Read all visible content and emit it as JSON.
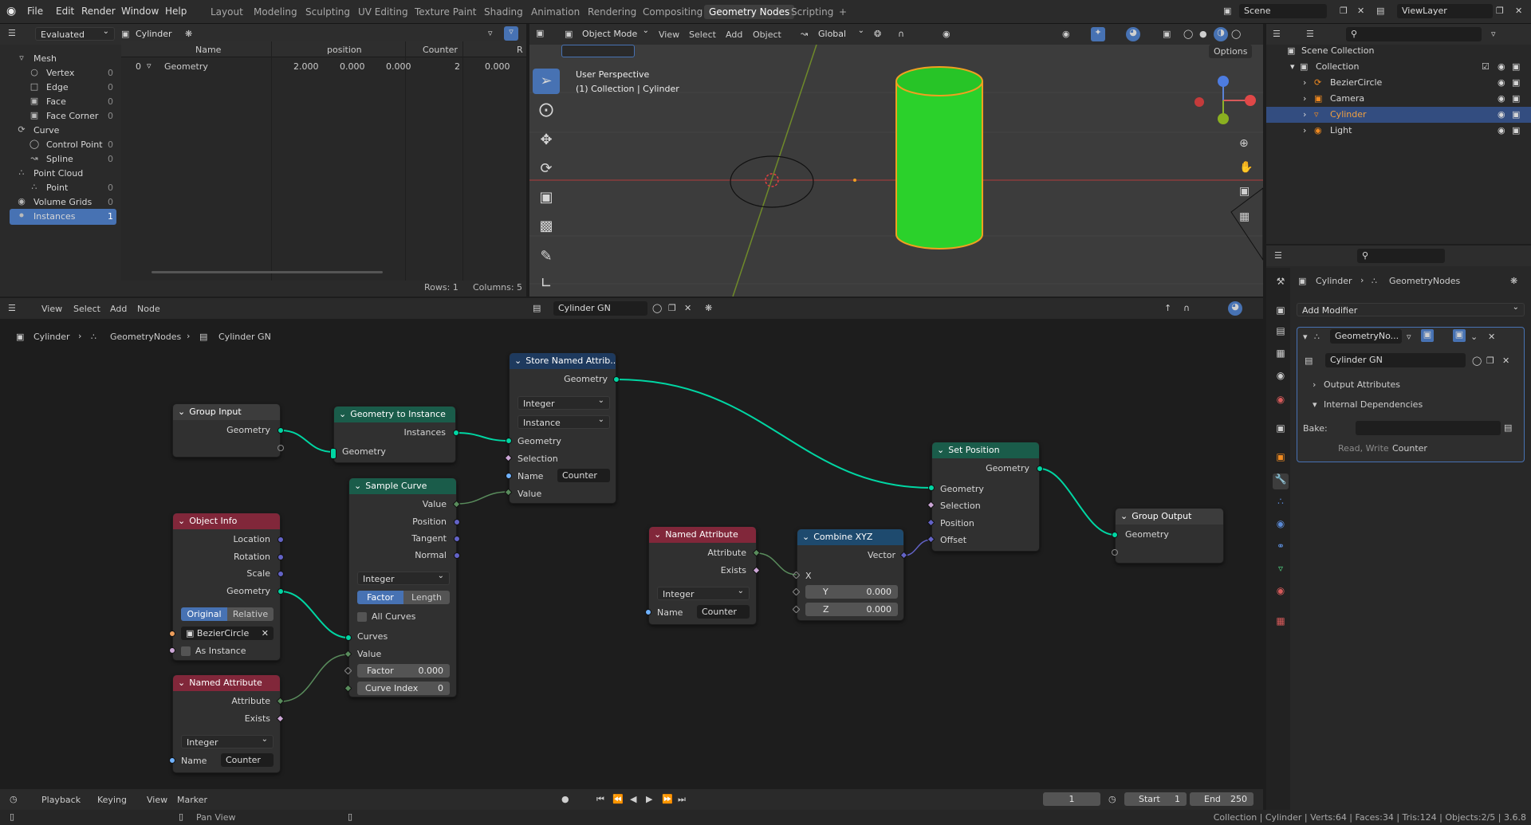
{
  "topbar": {
    "menus": [
      "File",
      "Edit",
      "Render",
      "Window",
      "Help"
    ],
    "workspaces": [
      "Layout",
      "Modeling",
      "Sculpting",
      "UV Editing",
      "Texture Paint",
      "Shading",
      "Animation",
      "Rendering",
      "Compositing",
      "Geometry Nodes",
      "Scripting"
    ],
    "active_workspace": "Geometry Nodes",
    "plus": "+",
    "scene": "Scene",
    "view_layer": "ViewLayer"
  },
  "spreadsheet": {
    "mode": "Evaluated",
    "object": "Cylinder",
    "tree": [
      {
        "label": "Mesh",
        "count": "",
        "sub": false,
        "icon": "mesh-icon"
      },
      {
        "label": "Vertex",
        "count": "0",
        "sub": true
      },
      {
        "label": "Edge",
        "count": "0",
        "sub": true
      },
      {
        "label": "Face",
        "count": "0",
        "sub": true
      },
      {
        "label": "Face Corner",
        "count": "0",
        "sub": true
      },
      {
        "label": "Curve",
        "count": "",
        "sub": false
      },
      {
        "label": "Control Point",
        "count": "0",
        "sub": true
      },
      {
        "label": "Spline",
        "count": "0",
        "sub": true
      },
      {
        "label": "Point Cloud",
        "count": "",
        "sub": false
      },
      {
        "label": "Point",
        "count": "0",
        "sub": true
      },
      {
        "label": "Volume Grids",
        "count": "0",
        "sub": false
      },
      {
        "label": "Instances",
        "count": "1",
        "sub": false,
        "active": true
      }
    ],
    "columns": [
      "Name",
      "position",
      "Counter",
      "R"
    ],
    "row": {
      "index": "0",
      "name": "Geometry",
      "px": "2.000",
      "py": "0.000",
      "pz": "0.000",
      "counter": "2",
      "r": "0.000"
    },
    "footer": {
      "rows": "Rows: 1",
      "cols": "Columns: 5"
    }
  },
  "viewport": {
    "mode": "Object Mode",
    "menus": [
      "View",
      "Select",
      "Add",
      "Object"
    ],
    "orientation": "Global",
    "options": "Options",
    "persp": "User Perspective",
    "collection": "(1) Collection | Cylinder",
    "colors": {
      "cylinder": "#2bd12b",
      "outline": "#f0a020"
    }
  },
  "outliner": {
    "root": "Scene Collection",
    "collection": "Collection",
    "items": [
      "BezierCircle",
      "Camera",
      "Cylinder",
      "Light"
    ],
    "active": "Cylinder"
  },
  "properties": {
    "breadcrumb": [
      "Cylinder",
      "GeometryNodes"
    ],
    "add_modifier": "Add Modifier",
    "modifier": "GeometryNo...",
    "tree": "Cylinder GN",
    "output_attrs": "Output Attributes",
    "internal_deps": "Internal Dependencies",
    "bake": "Bake:",
    "read_write": "Read, Write",
    "counter": "Counter"
  },
  "node_editor": {
    "menus": [
      "View",
      "Select",
      "Add",
      "Node"
    ],
    "tree_name": "Cylinder GN",
    "breadcrumb": [
      "Cylinder",
      "GeometryNodes",
      "Cylinder GN"
    ]
  },
  "nodes": {
    "group_input": {
      "title": "Group Input",
      "geometry": "Geometry"
    },
    "geo_to_inst": {
      "title": "Geometry to Instance",
      "instances": "Instances",
      "geometry": "Geometry"
    },
    "store": {
      "title": "Store Named Attrib...",
      "geometry_out": "Geometry",
      "type": "Integer",
      "domain": "Instance",
      "geometry": "Geometry",
      "selection": "Selection",
      "name": "Name",
      "name_val": "Counter",
      "value": "Value"
    },
    "sample": {
      "title": "Sample Curve",
      "value": "Value",
      "position": "Position",
      "tangent": "Tangent",
      "normal": "Normal",
      "type": "Integer",
      "factor": "Factor",
      "length": "Length",
      "all_curves": "All Curves",
      "curves": "Curves",
      "value_in": "Value",
      "factor_label": "Factor",
      "factor_val": "0.000",
      "curve_index": "Curve Index",
      "curve_index_val": "0"
    },
    "obj_info": {
      "title": "Object Info",
      "location": "Location",
      "rotation": "Rotation",
      "scale": "Scale",
      "geometry": "Geometry",
      "original": "Original",
      "relative": "Relative",
      "object": "BezierCircle",
      "as_instance": "As Instance"
    },
    "named_attr1": {
      "title": "Named Attribute",
      "attribute": "Attribute",
      "exists": "Exists",
      "type": "Integer",
      "name": "Name",
      "name_val": "Counter"
    },
    "named_attr2": {
      "title": "Named Attribute",
      "attribute": "Attribute",
      "exists": "Exists",
      "type": "Integer",
      "name": "Name",
      "name_val": "Counter"
    },
    "combine": {
      "title": "Combine XYZ",
      "vector": "Vector",
      "x": "X",
      "y": "Y",
      "y_val": "0.000",
      "z": "Z",
      "z_val": "0.000"
    },
    "set_pos": {
      "title": "Set Position",
      "geometry_out": "Geometry",
      "geometry": "Geometry",
      "selection": "Selection",
      "position": "Position",
      "offset": "Offset"
    },
    "group_output": {
      "title": "Group Output",
      "geometry": "Geometry"
    }
  },
  "timeline": {
    "menus": [
      "Playback",
      "Keying",
      "View",
      "Marker"
    ],
    "frame": "1",
    "start_label": "Start",
    "start": "1",
    "end_label": "End",
    "end": "250"
  },
  "status": {
    "pan": "Pan View",
    "info": "Collection | Cylinder | Verts:64 | Faces:34 | Tris:124 | Objects:2/5 | 3.6.8"
  }
}
